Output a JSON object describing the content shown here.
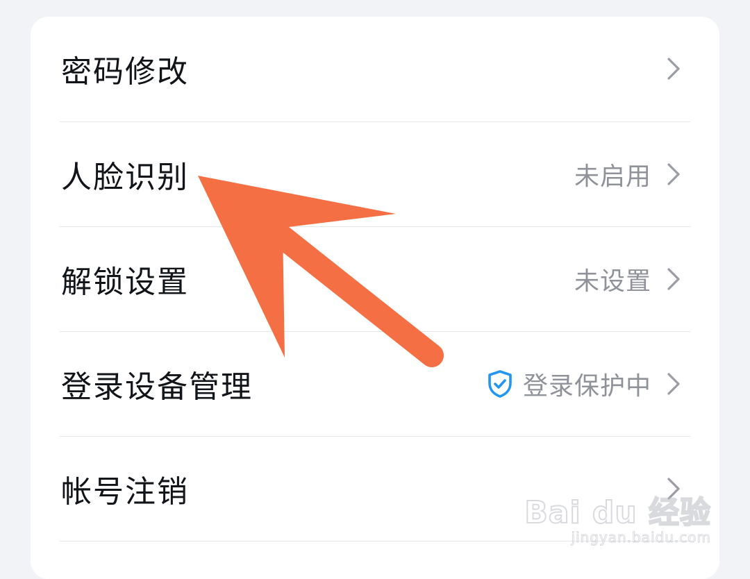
{
  "settings": {
    "items": [
      {
        "label": "密码修改",
        "status": "",
        "icon": "chevron-right-icon"
      },
      {
        "label": "人脸识别",
        "status": "未启用",
        "icon": "chevron-right-icon"
      },
      {
        "label": "解锁设置",
        "status": "未设置",
        "icon": "chevron-right-icon"
      },
      {
        "label": "登录设备管理",
        "status": "登录保护中",
        "status_icon": "shield-check-icon",
        "icon": "chevron-right-icon"
      },
      {
        "label": "帐号注销",
        "status": "",
        "icon": "chevron-right-icon"
      }
    ]
  },
  "annotation": {
    "type": "arrow",
    "color": "#f46f43"
  },
  "watermark": {
    "logo_text": "Bai du 经验",
    "url": "jingyan.baidu.com"
  },
  "colors": {
    "background": "#f2f3f7",
    "card": "#ffffff",
    "label": "#111418",
    "status": "#8f9399",
    "shield": "#2196f3",
    "chevron": "#9a9da3"
  }
}
